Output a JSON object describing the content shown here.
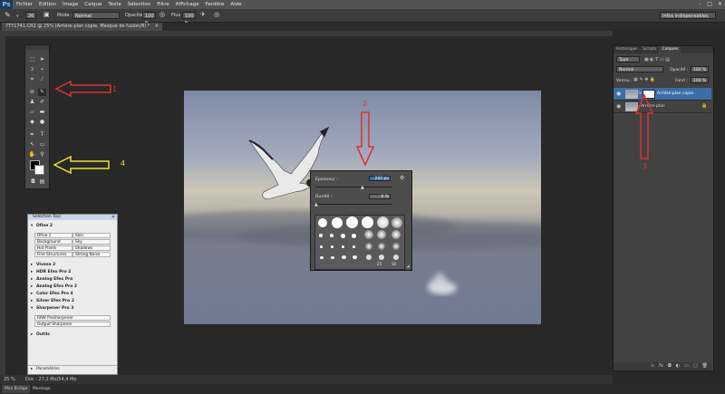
{
  "menubar": {
    "logo": "Ps",
    "items": [
      "Fichier",
      "Edition",
      "Image",
      "Calque",
      "Texte",
      "Sélection",
      "Filtre",
      "Affichage",
      "Fenêtre",
      "Aide"
    ]
  },
  "options": {
    "brush_size": "26",
    "mode_label": "Mode :",
    "mode_value": "Normal",
    "opacity_label": "Opacité :",
    "opacity_value": "100 %",
    "flow_label": "Flux :",
    "flow_value": "100 %",
    "workspace": "Infos indispensables"
  },
  "document": {
    "tab_title": "7TY1741.CR2 @ 25% (Arrière-plan copie, Masque de fusion/8) *"
  },
  "brush_popup": {
    "size_label": "Epaisseur :",
    "size_value": "243 px",
    "hardness_label": "Dureté :",
    "hardness_value": "0 %",
    "preset_numbers": [
      "25",
      "50"
    ]
  },
  "selection_tool": {
    "title": "Selection Tool",
    "dfine": {
      "header": "Dfine 2",
      "rows": [
        [
          "Dfine 2",
          "Skin"
        ],
        [
          "Background",
          "Sky"
        ],
        [
          "Hot Pixels",
          "Shadows"
        ],
        [
          "Fine Structures",
          "Strong Noise"
        ]
      ]
    },
    "plugins": [
      "Viveza 2",
      "HDR Efex Pro 2",
      "Analog Efex Pro",
      "Analog Efex Pro 2",
      "Color Efex Pro 4",
      "Silver Efex Pro 2"
    ],
    "sharpener": {
      "header": "Sharpener Pro 3",
      "rows": [
        "RAW Presharpener",
        "Output Sharpener"
      ]
    },
    "outils": "Outils",
    "parametres": "Paramètres"
  },
  "layers_panel": {
    "tabs": [
      "Historique",
      "Scripts",
      "Calques"
    ],
    "active_tab": "Calques",
    "kind": "Type",
    "blend_mode": "Normal",
    "opacity_label": "Opacité :",
    "opacity_value": "100 %",
    "lock_label": "Verrou :",
    "fill_label": "Fond :",
    "fill_value": "100 %",
    "layers": [
      {
        "name": "Arrière-plan copie",
        "selected": true
      },
      {
        "name": "Arrière-plan",
        "selected": false
      }
    ]
  },
  "status": {
    "zoom": "25 %",
    "doc": "Doc : 27,2 Mo/54,4 Mo"
  },
  "bottom_tabs": [
    "Mini Bridge",
    "Montage"
  ],
  "annotations": {
    "one": "1",
    "two": "2",
    "three": "3",
    "four": "4"
  },
  "colors": {
    "red_arrow": "#e03030",
    "yellow_arrow": "#f0e030",
    "accent_selected": "#3b6ea5"
  }
}
